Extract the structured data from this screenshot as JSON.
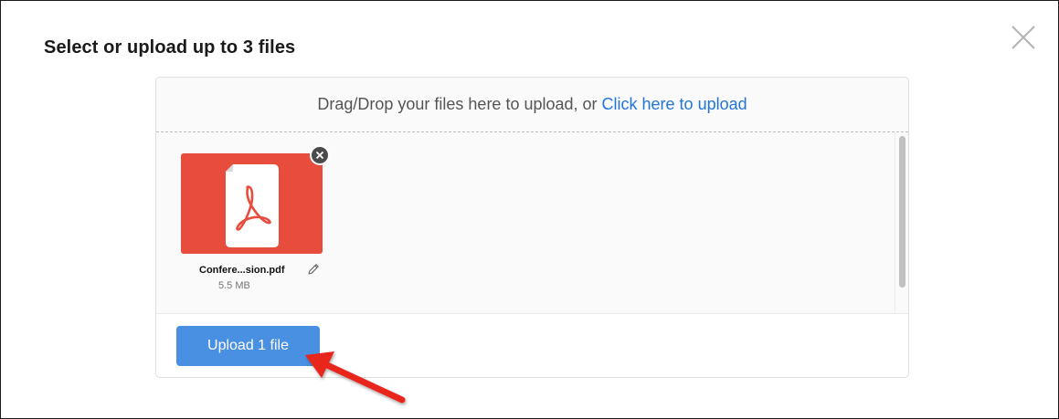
{
  "dialog": {
    "title": "Select or upload up to 3 files",
    "close_icon": "close-x-icon"
  },
  "dropzone": {
    "text": "Drag/Drop your files here to upload, or ",
    "link_text": "Click here to upload"
  },
  "files": [
    {
      "name": "Confere...sion.pdf",
      "size": "5.5 MB",
      "type_icon": "pdf-file-icon",
      "preview_color": "#e84c3d"
    }
  ],
  "actions": {
    "upload_label": "Upload 1 file"
  },
  "colors": {
    "accent": "#4a90e2",
    "link": "#2275d7",
    "pdf_red": "#e84c3d",
    "annotation_arrow": "#e8261f"
  }
}
